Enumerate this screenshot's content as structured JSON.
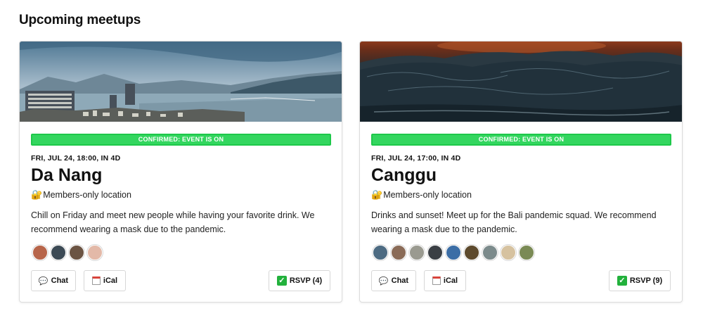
{
  "page": {
    "title": "Upcoming meetups"
  },
  "events": [
    {
      "banner": "CONFIRMED: EVENT IS ON",
      "datetime": "FRI, JUL 24, 18:00, IN 4D",
      "city": "Da Nang",
      "location_icon": "🔐",
      "location": "Members-only location",
      "description": "Chill on Friday and meet new people while having your favorite drink. We recommend wearing a mask due to the pandemic.",
      "avatar_colors": [
        "#b7654a",
        "#3c4a55",
        "#6b5443",
        "#e3b9a8"
      ],
      "buttons": {
        "chat": "Chat",
        "ical": "iCal",
        "rsvp": "RSVP (4)"
      }
    },
    {
      "banner": "CONFIRMED: EVENT IS ON",
      "datetime": "FRI, JUL 24, 17:00, IN 4D",
      "city": "Canggu",
      "location_icon": "🔐",
      "location": "Members-only location",
      "description": "Drinks and sunset! Meet up for the Bali pandemic squad. We recommend wearing a mask due to the pandemic.",
      "avatar_colors": [
        "#4d6b82",
        "#8a6b57",
        "#9a9a90",
        "#3a3f44",
        "#3c6ea6",
        "#5d4a2d",
        "#7c8b8c",
        "#d6c2a0",
        "#7a8a55"
      ],
      "buttons": {
        "chat": "Chat",
        "ical": "iCal",
        "rsvp": "RSVP (9)"
      }
    }
  ],
  "colors": {
    "banner": "#33d65f",
    "rsvp_check": "#22b13c"
  }
}
